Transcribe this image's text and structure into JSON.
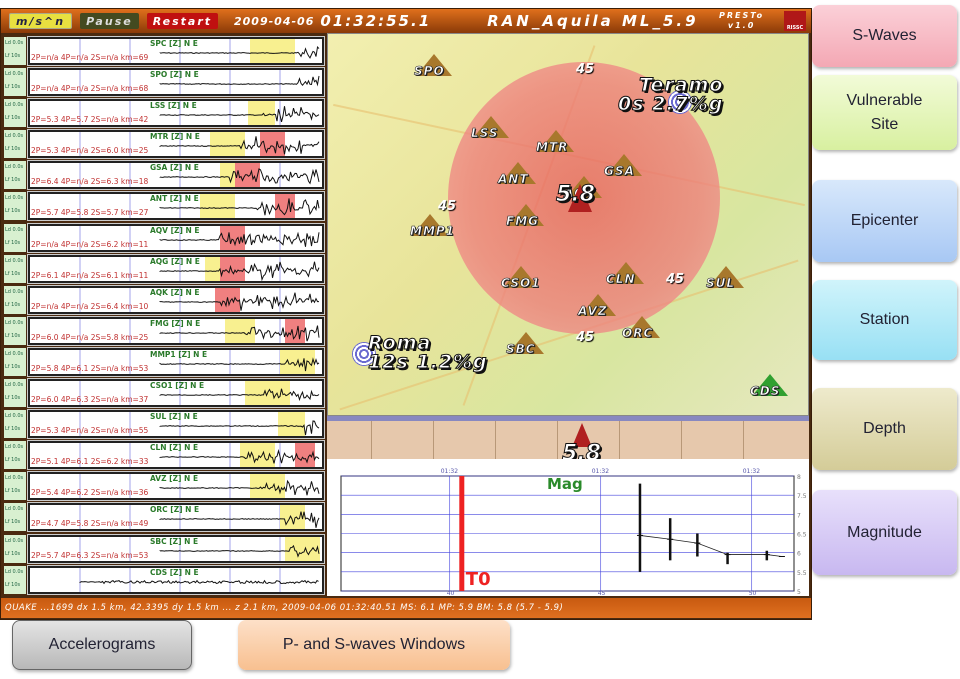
{
  "toolbar": {
    "units_label": "m/s^n",
    "pause_label": "Pause",
    "restart_label": "Restart",
    "date": "2009-04-06",
    "time": "01:32:55.1",
    "title": "RAN_Aquila ML_5.9",
    "app_name": "PRESTo",
    "app_version": "v1.0",
    "logo": "RISSC"
  },
  "row_labels": {
    "ld": "Ld 0.0s",
    "lf": "Lf 10s"
  },
  "stations": [
    {
      "name": "SPC [Z] N E",
      "params": "2P=n/a  4P=n/a  2S=n/a  km=69"
    },
    {
      "name": "SPO [Z] N E",
      "params": "2P=n/a  4P=n/a  2S=n/a  km=68"
    },
    {
      "name": "LSS [Z] N E",
      "params": "2P=5.3  4P=5.7  2S=n/a  km=42"
    },
    {
      "name": "MTR [Z] N E",
      "params": "2P=5.3  4P=n/a  2S=6.0  km=25"
    },
    {
      "name": "GSA [Z] N E",
      "params": "2P=6.4  4P=n/a  2S=6.3  km=18"
    },
    {
      "name": "ANT [Z] N E",
      "params": "2P=5.7  4P=5.8  2S=5.7  km=27"
    },
    {
      "name": "AQV [Z] N E",
      "params": "2P=n/a  4P=n/a  2S=6.2  km=11"
    },
    {
      "name": "AQG [Z] N E",
      "params": "2P=6.1  4P=n/a  2S=6.1  km=11"
    },
    {
      "name": "AQK [Z] N E",
      "params": "2P=n/a  4P=n/a  2S=6.4  km=10"
    },
    {
      "name": "FMG [Z] N E",
      "params": "2P=6.0  4P=n/a  2S=5.8  km=25"
    },
    {
      "name": "MMP1 [Z] N E",
      "params": "2P=5.8  4P=6.1  2S=n/a  km=53"
    },
    {
      "name": "CSO1 [Z] N E",
      "params": "2P=6.0  4P=6.3  2S=n/a  km=37"
    },
    {
      "name": "SUL [Z] N E",
      "params": "2P=5.3  4P=n/a  2S=n/a  km=55"
    },
    {
      "name": "CLN [Z] N E",
      "params": "2P=5.1  4P=6.1  2S=6.2  km=33"
    },
    {
      "name": "AVZ [Z] N E",
      "params": "2P=5.4  4P=6.2  2S=n/a  km=36"
    },
    {
      "name": "ORC [Z] N E",
      "params": "2P=4.7  4P=5.8  2S=n/a  km=49"
    },
    {
      "name": "SBC [Z] N E",
      "params": "2P=5.7  4P=6.3  2S=n/a  km=53"
    },
    {
      "name": "CDS [Z] N E",
      "params": ""
    }
  ],
  "map": {
    "stations": [
      "SPO",
      "LSS",
      "MTR",
      "ANT",
      "AQV",
      "GSA",
      "FMG",
      "MMP1",
      "CSO1",
      "CLN",
      "SUL",
      "AVZ",
      "ORC",
      "SBC",
      "CDS"
    ],
    "distance_labels": [
      "45",
      "45",
      "45",
      "45"
    ],
    "vulnerable_sites": [
      {
        "name": "Teramo",
        "info": "0s  2.7%g"
      },
      {
        "name": "Roma",
        "info": "12s  1.2%g"
      }
    ],
    "epicenter_magnitude": "5.8"
  },
  "depth": {
    "magnitude": "5.8"
  },
  "chart_data": {
    "type": "scatter",
    "title": "Mag",
    "xlim": [
      36.4,
      51.4
    ],
    "ylim": [
      5,
      8
    ],
    "x_ticks": [
      40,
      45,
      50
    ],
    "x_top_labels": [
      "01:32",
      "01:32",
      "01:32"
    ],
    "y_ticks": [
      5,
      5.5,
      6,
      6.5,
      7,
      7.5,
      8
    ],
    "t0_label": "T0",
    "t0_x": 40.4,
    "series": [
      {
        "x": [
          46.3,
          47.3,
          48.2,
          49.2,
          50.5,
          51.0
        ],
        "y": [
          6.45,
          6.35,
          6.25,
          5.95,
          5.95,
          5.9
        ],
        "err_low": [
          5.5,
          5.8,
          5.9,
          5.7,
          5.8,
          null
        ],
        "err_high": [
          7.8,
          6.9,
          6.5,
          6.0,
          6.05,
          null
        ]
      }
    ],
    "grid": true,
    "colors": {
      "t0": "#ee2222",
      "title": "#2a8a2a",
      "grid": "#4444dd"
    }
  },
  "status": "QUAKE  ...1699 dx 1.5 km, 42.3395 dy 1.5 km ... z 2.1 km, 2009-04-06 01:32:40.51 MS: 6.1 MP: 5.9 BM: 5.8 (5.7 - 5.9)",
  "callouts": {
    "s_waves": "S-Waves",
    "vulnerable_site": "Vulnerable Site",
    "epicenter": "Epicenter",
    "station": "Station",
    "depth": "Depth",
    "magnitude": "Magnitude",
    "accelerograms": "Accelerograms",
    "windows": "P- and S-waves Windows"
  }
}
